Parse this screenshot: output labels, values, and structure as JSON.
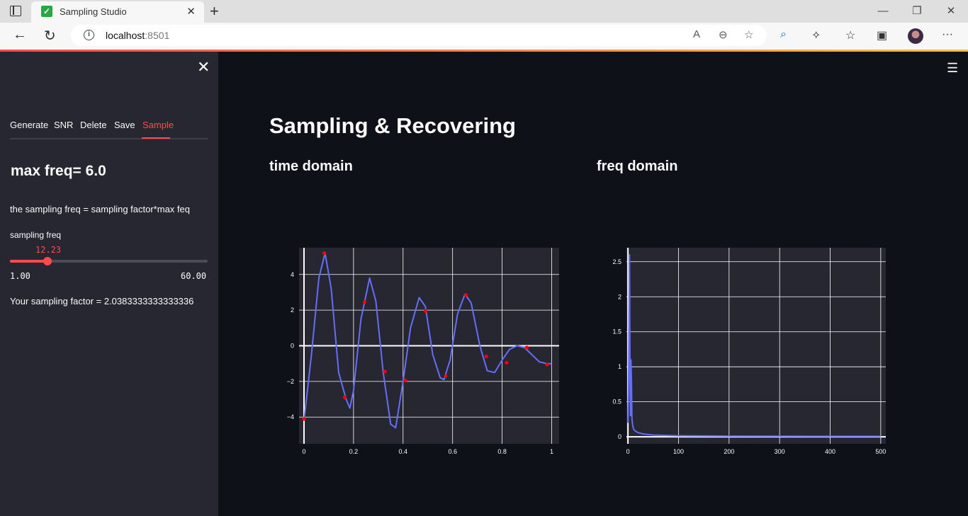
{
  "browser": {
    "tab_title": "Sampling Studio",
    "url_host": "localhost",
    "url_port": ":8501"
  },
  "sidebar": {
    "tabs": [
      {
        "label": "Generate",
        "active": false
      },
      {
        "label": "SNR",
        "active": false
      },
      {
        "label": "Delete",
        "active": false
      },
      {
        "label": "Save",
        "active": false
      },
      {
        "label": "Sample",
        "active": true
      }
    ],
    "max_freq_text": "max freq= 6.0",
    "note": "the sampling freq = sampling factor*max feq",
    "slider": {
      "label": "sampling freq",
      "value": 12.23,
      "value_text": "12.23",
      "min": 1.0,
      "max": 60.0,
      "min_text": "1.00",
      "max_text": "60.00"
    },
    "factor_text": "Your sampling factor = 2.0383333333333336"
  },
  "main": {
    "title": "Sampling & Recovering",
    "time_heading": "time domain",
    "freq_heading": "freq domain"
  },
  "colors": {
    "accent": "#ff4b4b",
    "signal": "#636efa",
    "sample_marker": "#ff0000",
    "plot_bg": "#262730"
  },
  "chart_data": [
    {
      "type": "line",
      "name": "time domain",
      "xlim": [
        -0.02,
        1.03
      ],
      "ylim": [
        -5.5,
        5.5
      ],
      "x_ticks": [
        0,
        0.2,
        0.4,
        0.6,
        0.8,
        1
      ],
      "x_tick_labels": [
        "0",
        "0.2",
        "0.4",
        "0.6",
        "0.8",
        "1"
      ],
      "y_ticks": [
        -4,
        -2,
        0,
        2,
        4
      ],
      "y_tick_labels": [
        "−4",
        "−2",
        "0",
        "2",
        "4"
      ],
      "grid": true,
      "series": [
        {
          "role": "signal",
          "x": [
            0,
            0.03,
            0.06,
            0.085,
            0.11,
            0.14,
            0.17,
            0.185,
            0.2,
            0.23,
            0.265,
            0.29,
            0.32,
            0.35,
            0.37,
            0.4,
            0.43,
            0.465,
            0.49,
            0.52,
            0.55,
            0.565,
            0.59,
            0.62,
            0.65,
            0.675,
            0.71,
            0.74,
            0.77,
            0.8,
            0.83,
            0.86,
            0.89,
            0.92,
            0.95,
            0.98,
            1.0
          ],
          "y": [
            -4.2,
            -0.5,
            3.8,
            5.2,
            3.2,
            -1.5,
            -3.0,
            -3.5,
            -2.5,
            1.5,
            3.8,
            2.5,
            -1.5,
            -4.4,
            -4.6,
            -2.0,
            1.0,
            2.7,
            2.2,
            -0.5,
            -1.8,
            -1.9,
            -0.8,
            1.8,
            2.9,
            2.4,
            0.0,
            -1.4,
            -1.5,
            -0.8,
            -0.2,
            0.0,
            -0.1,
            -0.5,
            -0.9,
            -1.0,
            -1.0
          ]
        },
        {
          "role": "samples",
          "x": [
            0,
            0.082,
            0.164,
            0.245,
            0.327,
            0.409,
            0.491,
            0.572,
            0.654,
            0.736,
            0.818,
            0.9,
            0.981
          ],
          "y": [
            -4.1,
            5.2,
            -2.9,
            2.45,
            -1.45,
            -1.95,
            1.95,
            -1.7,
            2.85,
            -0.6,
            -0.95,
            -0.1,
            -1.05
          ]
        }
      ]
    },
    {
      "type": "line",
      "name": "freq domain",
      "xlim": [
        -3,
        510
      ],
      "ylim": [
        -0.1,
        2.7
      ],
      "x_ticks": [
        0,
        100,
        200,
        300,
        400,
        500
      ],
      "x_tick_labels": [
        "0",
        "100",
        "200",
        "300",
        "400",
        "500"
      ],
      "y_ticks": [
        0,
        0.5,
        1,
        1.5,
        2,
        2.5
      ],
      "y_tick_labels": [
        "0",
        "0.5",
        "1",
        "1.5",
        "2",
        "2.5"
      ],
      "grid": true,
      "series": [
        {
          "role": "spectrum",
          "x": [
            0,
            1,
            2,
            3,
            4,
            5,
            6,
            7,
            8,
            9,
            10,
            12,
            15,
            20,
            30,
            50,
            100,
            200,
            300,
            400,
            500
          ],
          "y": [
            0.2,
            0.6,
            1.6,
            2.6,
            0.9,
            0.3,
            1.1,
            0.8,
            0.25,
            0.18,
            0.14,
            0.1,
            0.08,
            0.06,
            0.04,
            0.025,
            0.015,
            0.01,
            0.008,
            0.007,
            0.007
          ]
        }
      ]
    }
  ]
}
